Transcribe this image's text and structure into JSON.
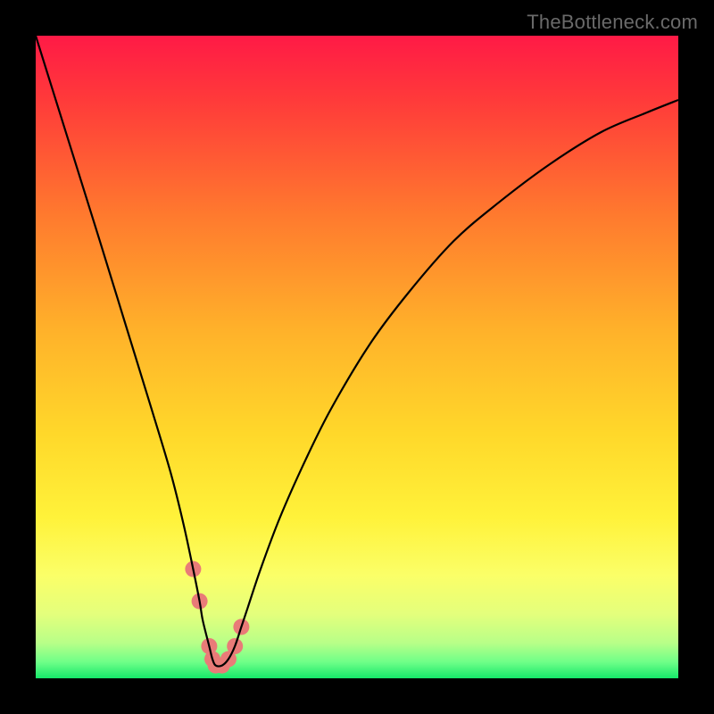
{
  "watermark": "TheBottleneck.com",
  "chart_data": {
    "type": "line",
    "title": "",
    "xlabel": "",
    "ylabel": "",
    "xlim": [
      0,
      100
    ],
    "ylim": [
      0,
      100
    ],
    "annotations": [],
    "series": [
      {
        "name": "curve",
        "x": [
          0,
          5,
          10,
          14,
          18,
          21,
          23,
          24.5,
          25.5,
          26,
          27,
          27.5,
          28,
          29,
          30,
          31,
          32,
          33,
          35,
          38,
          42,
          46,
          52,
          58,
          65,
          72,
          80,
          88,
          95,
          100
        ],
        "values": [
          100,
          84,
          68,
          55,
          42,
          32,
          24,
          17,
          12,
          9,
          5,
          3,
          2,
          2,
          3,
          5,
          8,
          11,
          17,
          25,
          34,
          42,
          52,
          60,
          68,
          74,
          80,
          85,
          88,
          90
        ]
      },
      {
        "name": "highlight-dots",
        "x": [
          24.5,
          25.5,
          27,
          27.5,
          28,
          29,
          30,
          31,
          32
        ],
        "values": [
          17,
          12,
          5,
          3,
          2,
          2,
          3,
          5,
          8
        ]
      }
    ],
    "gradient_stops": [
      {
        "offset": 0.0,
        "color": "#ff1a46"
      },
      {
        "offset": 0.1,
        "color": "#ff3a3a"
      },
      {
        "offset": 0.28,
        "color": "#ff7a2e"
      },
      {
        "offset": 0.46,
        "color": "#ffb22a"
      },
      {
        "offset": 0.62,
        "color": "#ffd82a"
      },
      {
        "offset": 0.75,
        "color": "#fff23a"
      },
      {
        "offset": 0.84,
        "color": "#fbff68"
      },
      {
        "offset": 0.9,
        "color": "#e4ff7c"
      },
      {
        "offset": 0.945,
        "color": "#b8ff88"
      },
      {
        "offset": 0.975,
        "color": "#6eff88"
      },
      {
        "offset": 1.0,
        "color": "#16e86a"
      }
    ],
    "highlight_color": "#e97b78",
    "highlight_radius": 9,
    "curve_stroke": "#000000",
    "curve_width": 2.2
  }
}
